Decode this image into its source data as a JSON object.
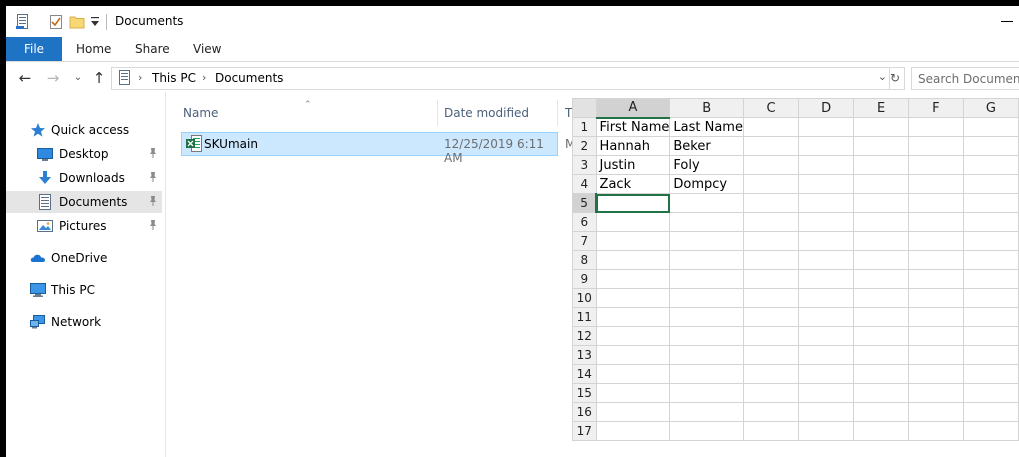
{
  "window": {
    "title": "Documents",
    "quick_access_icons": [
      "properties-icon",
      "new-folder-check-icon",
      "folder-icon",
      "customize-dropdown-icon"
    ]
  },
  "ribbon": {
    "tabs": [
      "File",
      "Home",
      "Share",
      "View"
    ]
  },
  "address_bar": {
    "crumbs": [
      "This PC",
      "Documents"
    ],
    "search_placeholder": "Search Documents"
  },
  "nav_pane": {
    "items": [
      {
        "label": "Quick access",
        "icon": "quick-access-star-icon",
        "pinned": false,
        "selected": false
      },
      {
        "label": "Desktop",
        "icon": "desktop-icon",
        "pinned": true,
        "selected": false
      },
      {
        "label": "Downloads",
        "icon": "downloads-icon",
        "pinned": true,
        "selected": false
      },
      {
        "label": "Documents",
        "icon": "documents-icon",
        "pinned": true,
        "selected": true
      },
      {
        "label": "Pictures",
        "icon": "pictures-icon",
        "pinned": true,
        "selected": false
      },
      {
        "label": "OneDrive",
        "icon": "onedrive-icon",
        "pinned": false,
        "selected": false
      },
      {
        "label": "This PC",
        "icon": "this-pc-icon",
        "pinned": false,
        "selected": false
      },
      {
        "label": "Network",
        "icon": "network-icon",
        "pinned": false,
        "selected": false
      }
    ]
  },
  "file_list": {
    "columns": {
      "name": "Name",
      "date_modified": "Date modified",
      "type_truncated": "T"
    },
    "files": [
      {
        "name": "SKUmain",
        "date_modified": "12/25/2019 6:11 AM",
        "type_truncated": "M",
        "icon": "excel-file-icon",
        "selected": true
      }
    ]
  },
  "preview": {
    "column_headers": [
      "A",
      "B",
      "C",
      "D",
      "E",
      "F",
      "G"
    ],
    "row_numbers": [
      "1",
      "2",
      "3",
      "4",
      "5",
      "6",
      "7",
      "8",
      "9",
      "10",
      "11",
      "12",
      "13",
      "14",
      "15",
      "16",
      "17"
    ],
    "rows": [
      [
        "First Name",
        "Last Name"
      ],
      [
        "Hannah",
        "Beker"
      ],
      [
        "Justin",
        "Foly"
      ],
      [
        "Zack",
        "Dompcy"
      ]
    ],
    "active_cell": "A5"
  },
  "colors": {
    "file_tab": "#1e73c4",
    "selection_fill": "#cce8ff",
    "selection_border": "#99d1ff",
    "excel_green": "#217346",
    "nav_selected": "#e5e5e5"
  }
}
